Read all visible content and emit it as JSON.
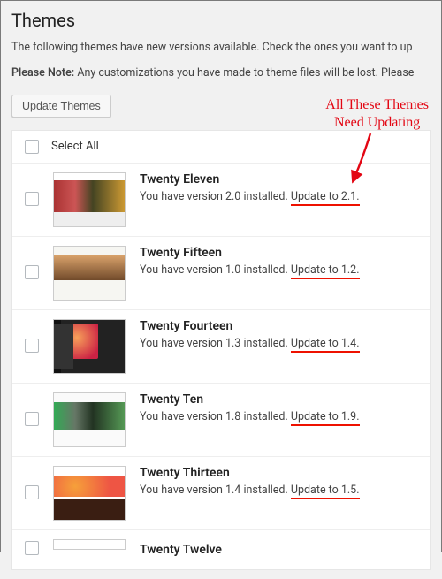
{
  "heading": "Themes",
  "intro": "The following themes have new versions available. Check the ones you want to up",
  "note_label": "Please Note:",
  "note_text": " Any customizations you have made to theme files will be lost. Please",
  "update_button": "Update Themes",
  "select_all": "Select All",
  "annotation_line1": "All These Themes",
  "annotation_line2": "Need Updating",
  "themes": [
    {
      "name": "Twenty Eleven",
      "installed": "You have version 2.0 installed. ",
      "update": "Update to 2.1."
    },
    {
      "name": "Twenty Fifteen",
      "installed": "You have version 1.0 installed. ",
      "update": "Update to 1.2."
    },
    {
      "name": "Twenty Fourteen",
      "installed": "You have version 1.3 installed. ",
      "update": "Update to 1.4."
    },
    {
      "name": "Twenty Ten",
      "installed": "You have version 1.8 installed. ",
      "update": "Update to 1.9."
    },
    {
      "name": "Twenty Thirteen",
      "installed": "You have version 1.4 installed. ",
      "update": "Update to 1.5."
    },
    {
      "name": "Twenty Twelve",
      "installed": "",
      "update": ""
    }
  ]
}
